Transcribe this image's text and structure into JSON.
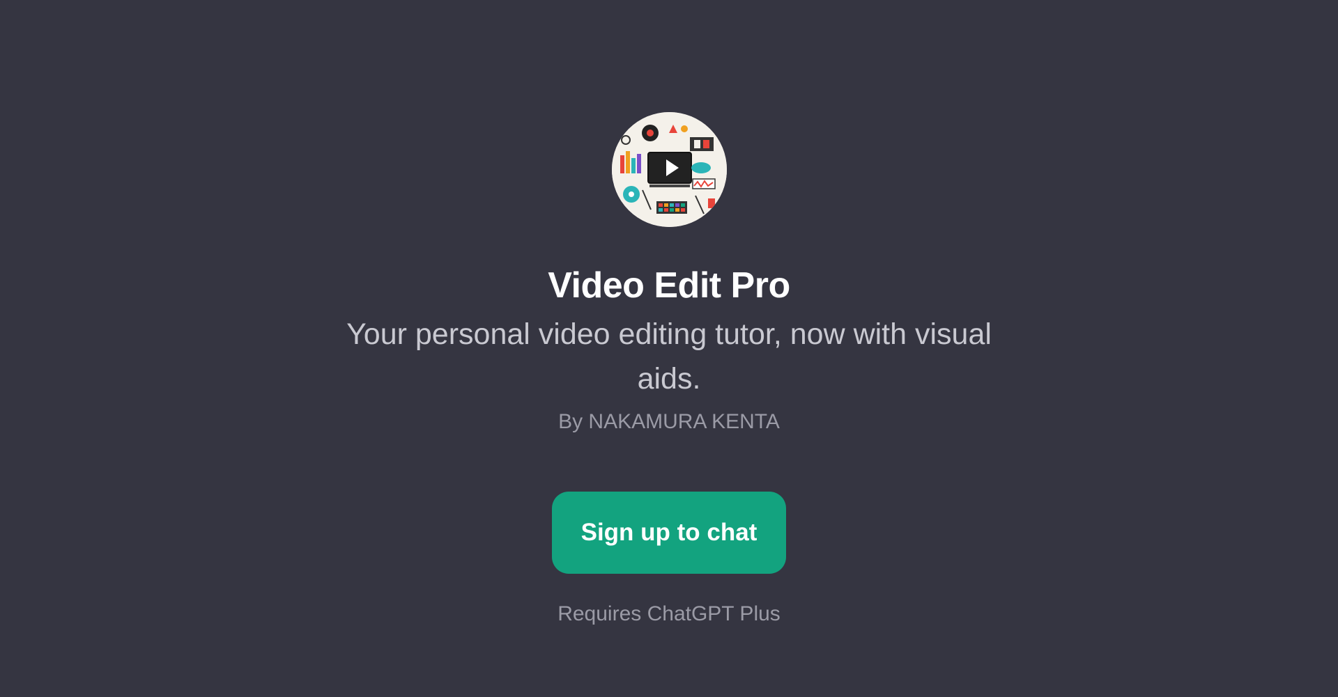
{
  "gpt": {
    "avatar_icon": "video-editing-collage-icon",
    "name": "Video Edit Pro",
    "description": "Your personal video editing tutor, now with visual aids.",
    "author": "By NAKAMURA KENTA"
  },
  "cta": {
    "label": "Sign up to chat"
  },
  "footer": {
    "note": "Requires ChatGPT Plus"
  },
  "colors": {
    "background": "#353541",
    "button": "#13a37f",
    "title": "#ffffff",
    "subtitle": "#c9c9d1",
    "muted": "#9b9ba6"
  }
}
